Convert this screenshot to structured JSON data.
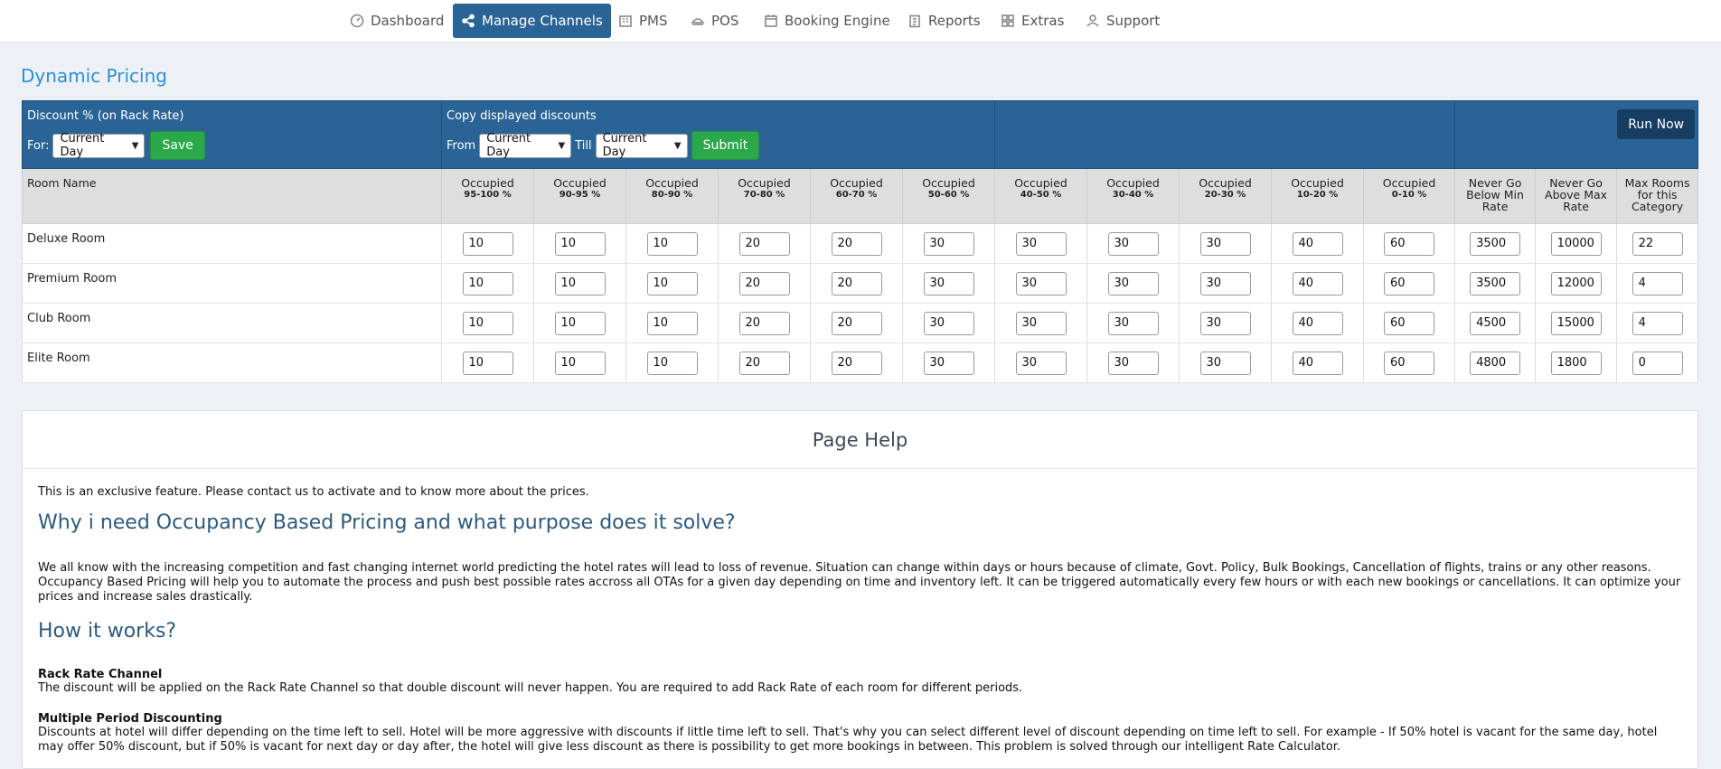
{
  "nav": {
    "items": [
      {
        "label": "Dashboard",
        "icon": "dashboard-icon"
      },
      {
        "label": "Manage Channels",
        "icon": "share-icon"
      },
      {
        "label": "PMS",
        "icon": "building-icon"
      },
      {
        "label": "POS",
        "icon": "printer-icon"
      },
      {
        "label": "Booking Engine",
        "icon": "calendar-icon"
      },
      {
        "label": "Reports",
        "icon": "clipboard-icon"
      },
      {
        "label": "Extras",
        "icon": "grid-icon"
      },
      {
        "label": "Support",
        "icon": "user-icon"
      }
    ],
    "active": "Manage Channels",
    "active_color": "#2a6496"
  },
  "page_title": "Dynamic Pricing",
  "controls": {
    "discount_label": "Discount % (on Rack Rate)",
    "for_label": "For:",
    "for_value": "Current Day",
    "save_label": "Save",
    "copy_label": "Copy displayed discounts",
    "from_label": "From",
    "from_value": "Current Day",
    "till_label": "Till",
    "till_value": "Current Day",
    "submit_label": "Submit",
    "run_now_label": "Run Now"
  },
  "table": {
    "room_name_header": "Room Name",
    "occupied_label": "Occupied",
    "occupancy_ranges": [
      "95-100 %",
      "90-95 %",
      "80-90 %",
      "70-80 %",
      "60-70 %",
      "50-60 %",
      "40-50 %",
      "30-40 %",
      "20-30 %",
      "10-20 %",
      "0-10 %"
    ],
    "min_rate_header": [
      "Never Go",
      "Below Min",
      "Rate"
    ],
    "max_rate_header": [
      "Never Go",
      "Above Max",
      "Rate"
    ],
    "max_rooms_header": [
      "Max Rooms",
      "for this",
      "Category"
    ],
    "rows": [
      {
        "name": "Deluxe Room",
        "discounts": [
          "10",
          "10",
          "10",
          "20",
          "20",
          "30",
          "30",
          "30",
          "30",
          "40",
          "60"
        ],
        "min_rate": "3500",
        "max_rate": "10000",
        "max_rooms": "22"
      },
      {
        "name": "Premium Room",
        "discounts": [
          "10",
          "10",
          "10",
          "20",
          "20",
          "30",
          "30",
          "30",
          "30",
          "40",
          "60"
        ],
        "min_rate": "3500",
        "max_rate": "12000",
        "max_rooms": "4"
      },
      {
        "name": "Club Room",
        "discounts": [
          "10",
          "10",
          "10",
          "20",
          "20",
          "30",
          "30",
          "30",
          "30",
          "40",
          "60"
        ],
        "min_rate": "4500",
        "max_rate": "15000",
        "max_rooms": "4"
      },
      {
        "name": "Elite Room",
        "discounts": [
          "10",
          "10",
          "10",
          "20",
          "20",
          "30",
          "30",
          "30",
          "30",
          "40",
          "60"
        ],
        "min_rate": "4800",
        "max_rate": "1800",
        "max_rooms": "0"
      }
    ]
  },
  "help": {
    "title": "Page Help",
    "intro": "This is an exclusive feature. Please contact us to activate and to know more about the prices.",
    "why_heading": "Why i need Occupancy Based Pricing and what purpose does it solve?",
    "why_text": "We all know with the increasing competition and fast changing internet world predicting the hotel rates will lead to loss of revenue. Situation can change within days or hours because of climate, Govt. Policy, Bulk Bookings, Cancellation of flights, trains or any other reasons. Occupancy Based Pricing will help you to automate the process and push best possible rates accross all OTAs for a given day depending on time and inventory left. It can be triggered automatically every few hours or with each new bookings or cancellations. It can optimize your prices and increase sales drastically.",
    "how_heading": "How it works?",
    "rack_heading": "Rack Rate Channel",
    "rack_text": "The discount will be applied on the Rack Rate Channel so that double discount will never happen. You are required to add Rack Rate of each room for different periods.",
    "multi_heading": "Multiple Period Discounting",
    "multi_text": "Discounts at hotel will differ depending on the time left to sell. Hotel will be more aggressive with discounts if little time left to sell. That's why you can select different level of discount depending on time left to sell. For example - If 50% hotel is vacant for the same day, hotel may offer 50% discount, but if 50% is vacant for next day or day after, the hotel will give less discount as there is possibility to get more bookings in between. This problem is solved through our intelligent Rate Calculator."
  }
}
